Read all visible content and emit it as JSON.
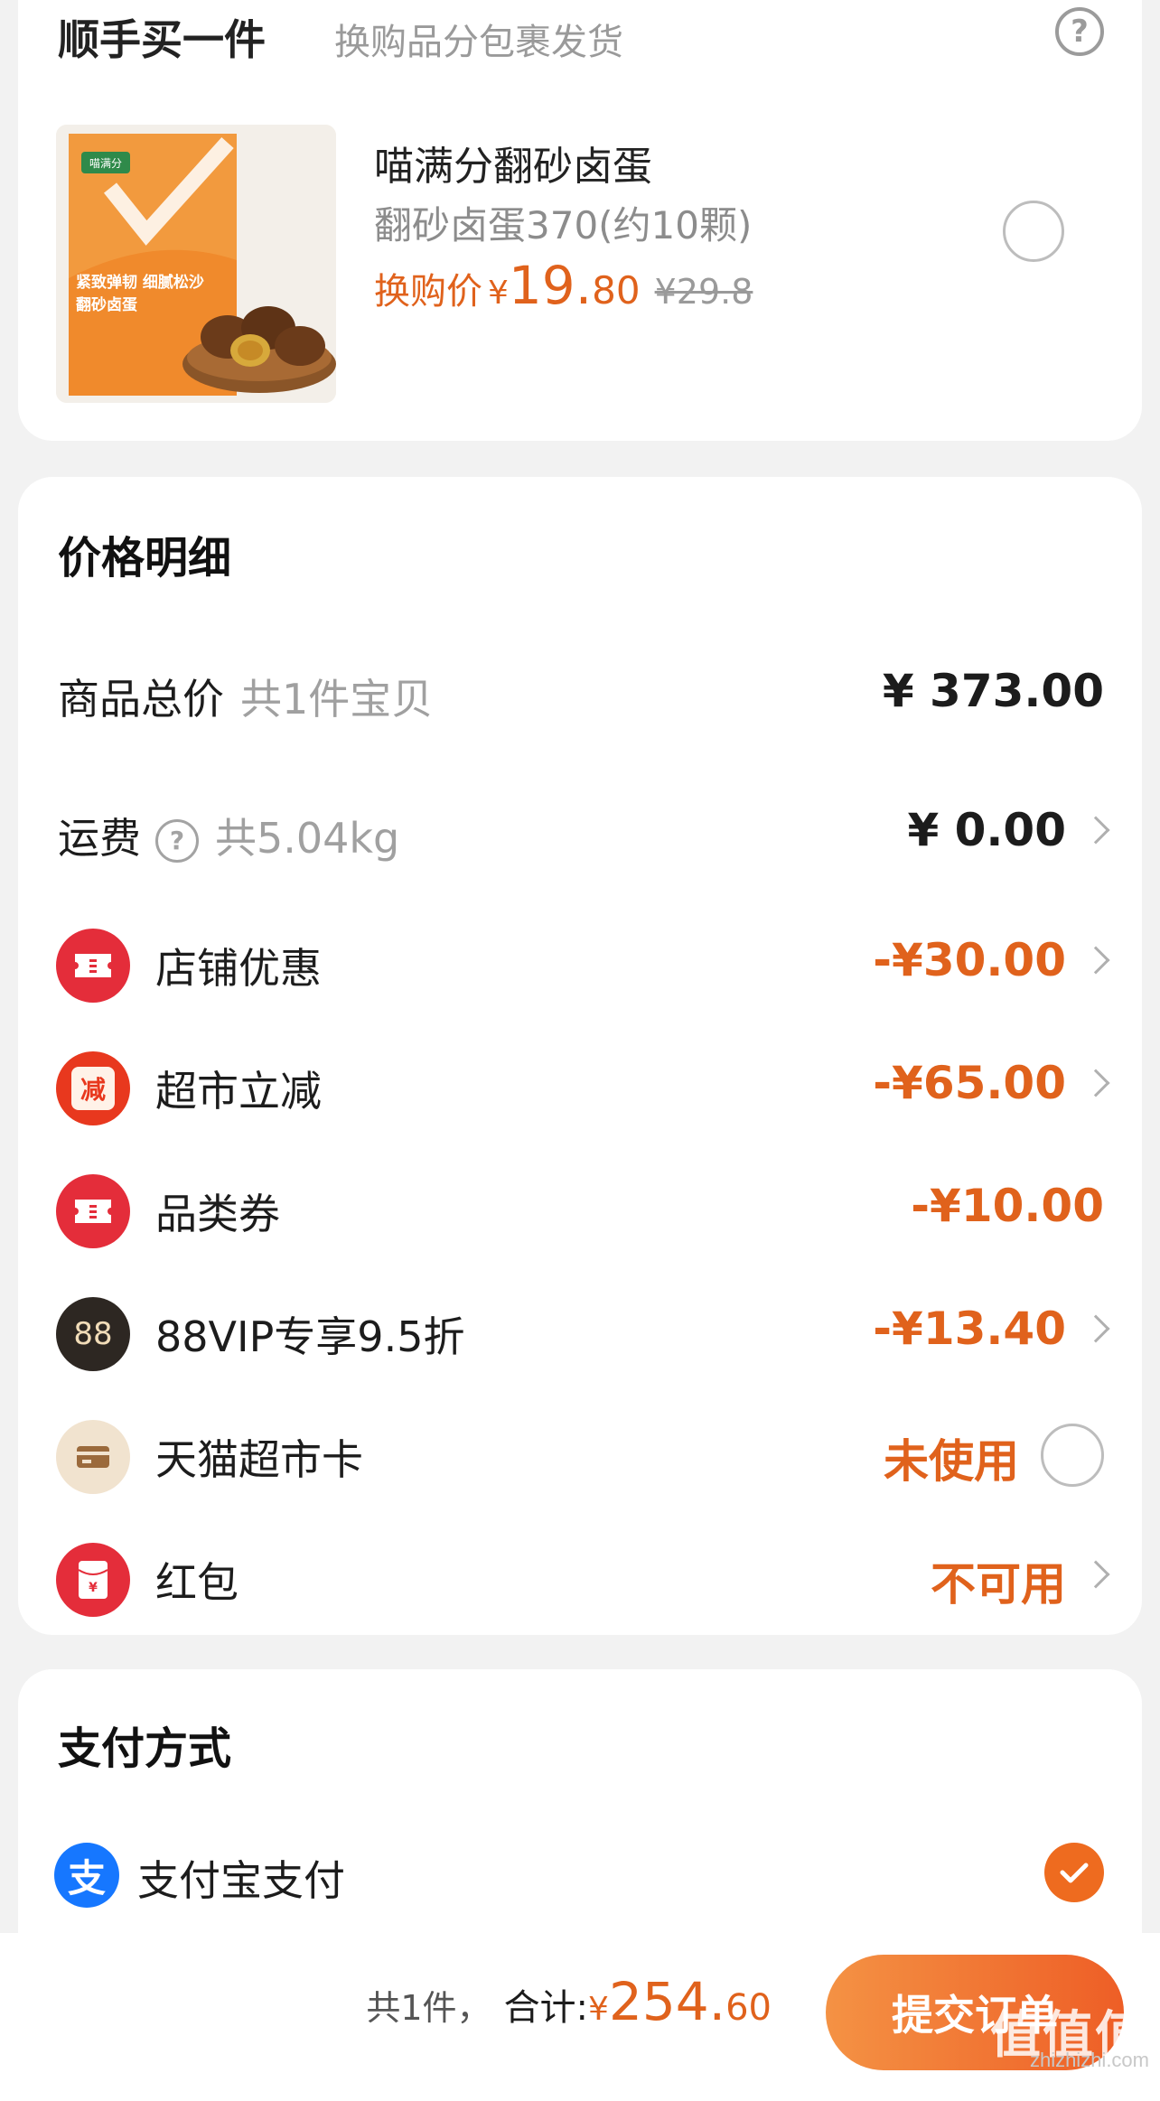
{
  "addon": {
    "title": "顺手买一件",
    "subtitle": "换购品分包裹发货",
    "help_icon": "question-circle-icon",
    "product": {
      "name": "喵满分翻砂卤蛋",
      "spec": "翻砂卤蛋370(约10颗)",
      "price_label": "换购价",
      "price_yen": "¥",
      "price_int": "19.",
      "price_dec": "80",
      "original_price": "¥29.8",
      "image_texts": [
        "喵满分",
        "紧致弹韧 细腻松沙",
        "翻砂卤蛋"
      ]
    }
  },
  "price_detail": {
    "title": "价格明细",
    "rows": [
      {
        "label": "商品总价",
        "sub": "共1件宝贝",
        "value": "¥ 373.00"
      },
      {
        "label": "运费",
        "sub": "共5.04kg",
        "value": "¥ 0.00"
      },
      {
        "label": "店铺优惠",
        "value": "-¥30.00"
      },
      {
        "label": "超市立减",
        "value": "-¥65.00",
        "icon_text": "减"
      },
      {
        "label": "品类券",
        "value": "-¥10.00"
      },
      {
        "label": "88VIP专享9.5折",
        "value": "-¥13.40",
        "icon_text": "88"
      },
      {
        "label": "天猫超市卡",
        "value": "未使用"
      },
      {
        "label": "红包",
        "value": "不可用",
        "icon_text": "¥"
      }
    ]
  },
  "payment": {
    "title": "支付方式",
    "method": "支付宝支付",
    "icon_text": "支"
  },
  "bottom_bar": {
    "count": "共1件，",
    "total_label": "合计:",
    "total_yen": "¥",
    "total_int": "254.",
    "total_dec": "60",
    "submit_label": "提交订单"
  },
  "watermark": {
    "logo": "值值值",
    "text": "zhizhizhi.com"
  },
  "colors": {
    "accent": "#e0621c",
    "coupon_red": "#e42d3a",
    "submit_gradient_start": "#f49244",
    "submit_gradient_end": "#ee5e26",
    "alipay_blue": "#1677ff"
  }
}
